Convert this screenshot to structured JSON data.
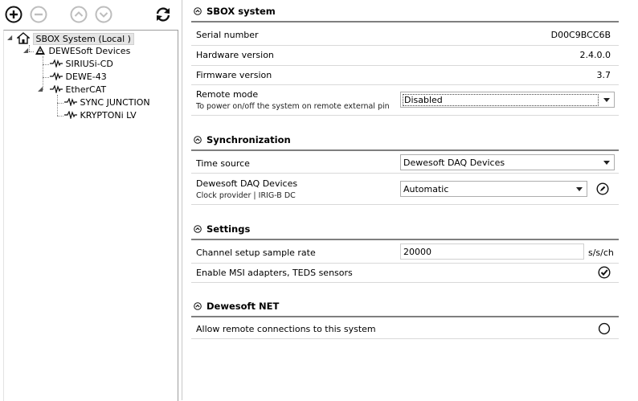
{
  "toolbar": {
    "add_icon": "plus-circle-icon",
    "remove_icon": "minus-circle-icon",
    "up_icon": "chevron-up-circle-icon",
    "down_icon": "chevron-down-circle-icon",
    "refresh_icon": "refresh-icon"
  },
  "tree": {
    "root": {
      "label": "SBOX System (Local )",
      "icon": "home-icon"
    },
    "dewesoft_devices": {
      "label": "DEWESoft Devices",
      "icon": "warning-triangle-icon"
    },
    "sirius": {
      "label": "SIRIUSi-CD",
      "icon": "signal-wave-icon"
    },
    "dewe43": {
      "label": "DEWE-43",
      "icon": "signal-wave-icon"
    },
    "ethercat": {
      "label": "EtherCAT",
      "icon": "signal-wave-icon"
    },
    "sync_junction": {
      "label": "SYNC JUNCTION",
      "icon": "signal-wave-icon"
    },
    "krypton": {
      "label": "KRYPTONi LV",
      "icon": "signal-wave-icon"
    }
  },
  "sbox_system": {
    "title": "SBOX system",
    "serial_label": "Serial number",
    "serial_value": "D00C9BCC6B",
    "hardware_label": "Hardware version",
    "hardware_value": "2.4.0.0",
    "firmware_label": "Firmware version",
    "firmware_value": "3.7",
    "remote_mode_label": "Remote mode",
    "remote_mode_sub": "To power on/off the system on remote external pin",
    "remote_mode_value": "Disabled"
  },
  "synchronization": {
    "title": "Synchronization",
    "time_source_label": "Time source",
    "time_source_value": "Dewesoft DAQ Devices",
    "daq_label": "Dewesoft DAQ Devices",
    "daq_sub": "Clock provider | IRIG-B DC",
    "daq_value": "Automatic",
    "edit_icon": "edit-pen-circle-icon"
  },
  "settings": {
    "title": "Settings",
    "sample_rate_label": "Channel setup sample rate",
    "sample_rate_value": "20000",
    "sample_rate_unit": "s/s/ch",
    "msi_label": "Enable MSI adapters, TEDS sensors",
    "msi_checked": true
  },
  "dewesoft_net": {
    "title": "Dewesoft NET",
    "remote_label": "Allow remote connections to this system",
    "remote_checked": false
  }
}
